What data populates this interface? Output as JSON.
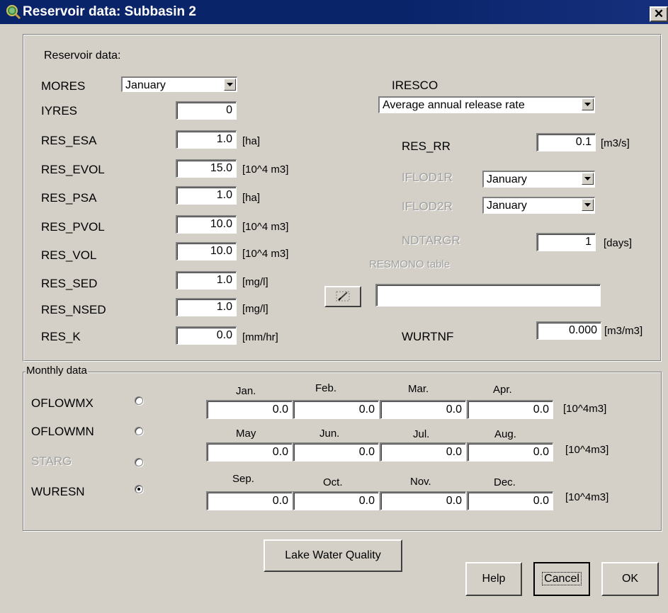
{
  "window": {
    "title": "Reservoir data: Subbasin 2",
    "close_glyph": "✕",
    "icon": "magnifier-icon"
  },
  "reservoir": {
    "section_label": "Reservoir data:",
    "mores": {
      "label": "MORES",
      "value": "January"
    },
    "iyres": {
      "label": "IYRES",
      "value": "0"
    },
    "res_esa": {
      "label": "RES_ESA",
      "value": "1.0",
      "unit": "[ha]"
    },
    "res_evol": {
      "label": "RES_EVOL",
      "value": "15.0",
      "unit": "[10^4 m3]"
    },
    "res_psa": {
      "label": "RES_PSA",
      "value": "1.0",
      "unit": "[ha]"
    },
    "res_pvol": {
      "label": "RES_PVOL",
      "value": "10.0",
      "unit": "[10^4 m3]"
    },
    "res_vol": {
      "label": "RES_VOL",
      "value": "10.0",
      "unit": "[10^4 m3]"
    },
    "res_sed": {
      "label": "RES_SED",
      "value": "1.0",
      "unit": "[mg/l]"
    },
    "res_nsed": {
      "label": "RES_NSED",
      "value": "1.0",
      "unit": "[mg/l]"
    },
    "res_k": {
      "label": "RES_K",
      "value": "0.0",
      "unit": "[mm/hr]"
    }
  },
  "right": {
    "iresco": {
      "label": "IRESCO",
      "value": "Average annual release rate"
    },
    "res_rr": {
      "label": "RES_RR",
      "value": "0.1",
      "unit": "[m3/s]"
    },
    "iflod1r": {
      "label": "IFLOD1R",
      "value": "January"
    },
    "iflod2r": {
      "label": "IFLOD2R",
      "value": "January"
    },
    "ndtargr": {
      "label": "NDTARGR",
      "value": "1",
      "unit": "[days]"
    },
    "resmono": {
      "label": "RESMONO table",
      "value": ""
    },
    "wurtnf": {
      "label": "WURTNF",
      "value": "0.000",
      "unit": "[m3/m3]"
    }
  },
  "monthly": {
    "group_label": "Monthly data",
    "options": [
      {
        "label": "OFLOWMX",
        "selected": false,
        "disabled": false
      },
      {
        "label": "OFLOWMN",
        "selected": false,
        "disabled": false
      },
      {
        "label": "STARG",
        "selected": false,
        "disabled": true
      },
      {
        "label": "WURESN",
        "selected": true,
        "disabled": false
      }
    ],
    "months": [
      "Jan.",
      "Feb.",
      "Mar.",
      "Apr.",
      "May",
      "Jun.",
      "Jul.",
      "Aug.",
      "Sep.",
      "Oct.",
      "Nov.",
      "Dec."
    ],
    "values": [
      "0.0",
      "0.0",
      "0.0",
      "0.0",
      "0.0",
      "0.0",
      "0.0",
      "0.0",
      "0.0",
      "0.0",
      "0.0",
      "0.0"
    ],
    "unit": "[10^4m3]"
  },
  "buttons": {
    "lake_water_quality": "Lake Water Quality",
    "help": "Help",
    "cancel": "Cancel",
    "ok": "OK"
  }
}
